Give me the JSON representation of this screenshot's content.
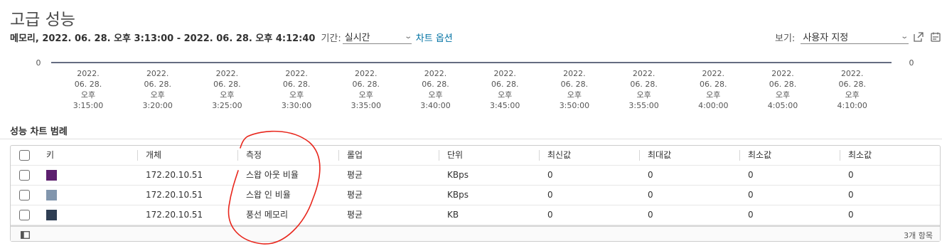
{
  "page": {
    "title": "고급 성능",
    "range_text": "메모리, 2022. 06. 28. 오후 3:13:00 - 2022. 06. 28. 오후 4:12:40",
    "period_label": "기간:",
    "period_value": "실시간",
    "chart_options_label": "차트 옵션",
    "view_label": "보기:",
    "view_value": "사용자 지정",
    "icons": [
      "chevron-down-icon",
      "popout-icon",
      "export-icon",
      "column-toggle-icon"
    ]
  },
  "chart_data": {
    "type": "line",
    "y_left_tick": "0",
    "y_right_tick": "0",
    "x_ticks": [
      [
        "2022.",
        "06. 28.",
        "오후",
        "3:15:00"
      ],
      [
        "2022.",
        "06. 28.",
        "오후",
        "3:20:00"
      ],
      [
        "2022.",
        "06. 28.",
        "오후",
        "3:25:00"
      ],
      [
        "2022.",
        "06. 28.",
        "오후",
        "3:30:00"
      ],
      [
        "2022.",
        "06. 28.",
        "오후",
        "3:35:00"
      ],
      [
        "2022.",
        "06. 28.",
        "오후",
        "3:40:00"
      ],
      [
        "2022.",
        "06. 28.",
        "오후",
        "3:45:00"
      ],
      [
        "2022.",
        "06. 28.",
        "오후",
        "3:50:00"
      ],
      [
        "2022.",
        "06. 28.",
        "오후",
        "3:55:00"
      ],
      [
        "2022.",
        "06. 28.",
        "오후",
        "4:00:00"
      ],
      [
        "2022.",
        "06. 28.",
        "오후",
        "4:05:00"
      ],
      [
        "2022.",
        "06. 28.",
        "오후",
        "4:10:00"
      ]
    ],
    "series": [
      {
        "name": "스왑 아웃 비율",
        "color": "#5c1f6e",
        "values": [
          0,
          0,
          0,
          0,
          0,
          0,
          0,
          0,
          0,
          0,
          0,
          0
        ]
      },
      {
        "name": "스왑 인 비율",
        "color": "#8296ad",
        "values": [
          0,
          0,
          0,
          0,
          0,
          0,
          0,
          0,
          0,
          0,
          0,
          0
        ]
      },
      {
        "name": "풍선 메모리",
        "color": "#2f3e53",
        "values": [
          0,
          0,
          0,
          0,
          0,
          0,
          0,
          0,
          0,
          0,
          0,
          0
        ]
      }
    ]
  },
  "legend": {
    "title": "성능 차트 범례",
    "columns": [
      "키",
      "개체",
      "측정",
      "롤업",
      "단위",
      "최신값",
      "최대값",
      "최소값",
      "최소값"
    ],
    "rows": [
      {
        "color": "#5c1f6e",
        "object": "172.20.10.51",
        "measure": "스왑 아웃 비율",
        "rollup": "평균",
        "unit": "KBps",
        "latest": "0",
        "max": "0",
        "min": "0",
        "min2": "0"
      },
      {
        "color": "#8296ad",
        "object": "172.20.10.51",
        "measure": "스왑 인 비율",
        "rollup": "평균",
        "unit": "KBps",
        "latest": "0",
        "max": "0",
        "min": "0",
        "min2": "0"
      },
      {
        "color": "#2f3e53",
        "object": "172.20.10.51",
        "measure": "풍선 메모리",
        "rollup": "평균",
        "unit": "KB",
        "latest": "0",
        "max": "0",
        "min": "0",
        "min2": "0"
      }
    ],
    "footer_count": "3개 항목"
  }
}
